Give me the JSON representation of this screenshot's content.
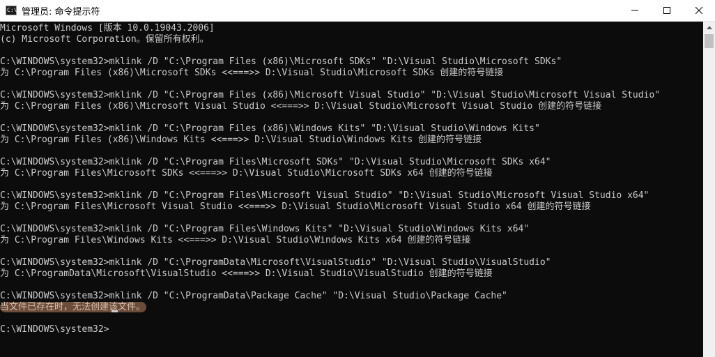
{
  "window": {
    "title": "管理员: 命令提示符",
    "icon_label": "C:\\"
  },
  "console": {
    "lines": [
      "Microsoft Windows [版本 10.0.19043.2006]",
      "(c) Microsoft Corporation。保留所有权利。",
      "",
      "C:\\WINDOWS\\system32>mklink /D \"C:\\Program Files (x86)\\Microsoft SDKs\" \"D:\\Visual Studio\\Microsoft SDKs\"",
      "为 C:\\Program Files (x86)\\Microsoft SDKs <<===>> D:\\Visual Studio\\Microsoft SDKs 创建的符号链接",
      "",
      "C:\\WINDOWS\\system32>mklink /D \"C:\\Program Files (x86)\\Microsoft Visual Studio\" \"D:\\Visual Studio\\Microsoft Visual Studio\"",
      "为 C:\\Program Files (x86)\\Microsoft Visual Studio <<===>> D:\\Visual Studio\\Microsoft Visual Studio 创建的符号链接",
      "",
      "C:\\WINDOWS\\system32>mklink /D \"C:\\Program Files (x86)\\Windows Kits\" \"D:\\Visual Studio\\Windows Kits\"",
      "为 C:\\Program Files (x86)\\Windows Kits <<===>> D:\\Visual Studio\\Windows Kits 创建的符号链接",
      "",
      "C:\\WINDOWS\\system32>mklink /D \"C:\\Program Files\\Microsoft SDKs\" \"D:\\Visual Studio\\Microsoft SDKs x64\"",
      "为 C:\\Program Files\\Microsoft SDKs <<===>> D:\\Visual Studio\\Microsoft SDKs x64 创建的符号链接",
      "",
      "C:\\WINDOWS\\system32>mklink /D \"C:\\Program Files\\Microsoft Visual Studio\" \"D:\\Visual Studio\\Microsoft Visual Studio x64\"",
      "为 C:\\Program Files\\Microsoft Visual Studio <<===>> D:\\Visual Studio\\Microsoft Visual Studio x64 创建的符号链接",
      "",
      "C:\\WINDOWS\\system32>mklink /D \"C:\\Program Files\\Windows Kits\" \"D:\\Visual Studio\\Windows Kits x64\"",
      "为 C:\\Program Files\\Windows Kits <<===>> D:\\Visual Studio\\Windows Kits x64 创建的符号链接",
      "",
      "C:\\WINDOWS\\system32>mklink /D \"C:\\ProgramData\\Microsoft\\VisualStudio\" \"D:\\Visual Studio\\VisualStudio\"",
      "为 C:\\ProgramData\\Microsoft\\VisualStudio <<===>> D:\\Visual Studio\\VisualStudio 创建的符号链接",
      "",
      "C:\\WINDOWS\\system32>mklink /D \"C:\\ProgramData\\Package Cache\" \"D:\\Visual Studio\\Package Cache\"",
      "当文件已存在时，无法创建该文件。",
      "",
      "C:\\WINDOWS\\system32>"
    ],
    "highlighted_line_index": 25
  },
  "colors": {
    "console_background": "#0c0c0c",
    "console_text": "#cccccc",
    "highlight_background": "#6b4c3a"
  }
}
